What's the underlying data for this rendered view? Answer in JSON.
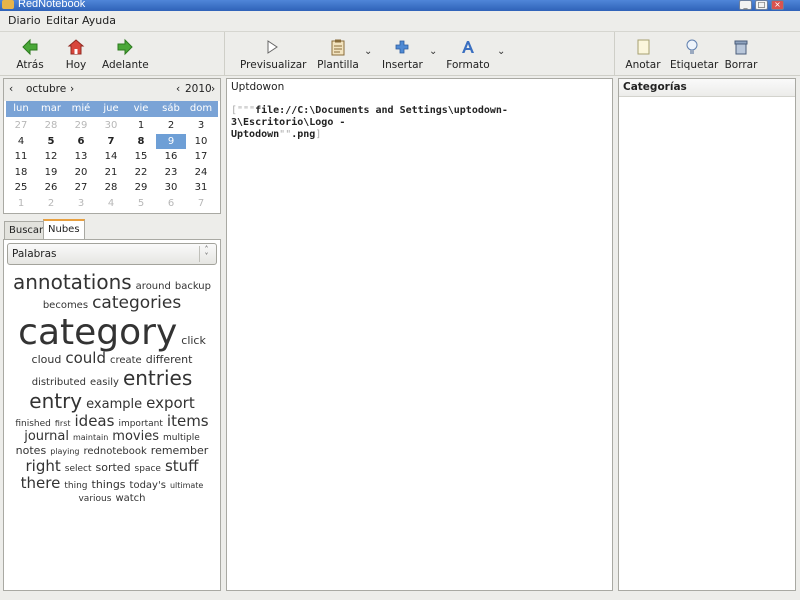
{
  "window": {
    "title": "RedNotebook"
  },
  "menu": [
    "Diario",
    "Editar",
    "Ayuda"
  ],
  "toolbar": {
    "nav": [
      {
        "label": "Atrás",
        "icon": "arrow-left-icon",
        "color": "#3f9a2c"
      },
      {
        "label": "Hoy",
        "icon": "home-icon",
        "color": "#c6332c"
      },
      {
        "label": "Adelante",
        "icon": "arrow-right-icon",
        "color": "#3f9a2c"
      }
    ],
    "edit": [
      {
        "label": "Previsualizar",
        "icon": "play-icon"
      },
      {
        "label": "Plantilla",
        "icon": "clipboard-icon"
      },
      {
        "label": "Insertar",
        "icon": "plus-icon",
        "color": "#3474c2"
      },
      {
        "label": "Formato",
        "icon": "format-text-icon",
        "color": "#3474c2"
      }
    ],
    "right": [
      {
        "label": "Anotar",
        "icon": "note-icon"
      },
      {
        "label": "Etiquetar",
        "icon": "lightbulb-icon"
      },
      {
        "label": "Borrar",
        "icon": "trash-icon"
      }
    ]
  },
  "calendar": {
    "month": "octubre",
    "year": "2010",
    "weekdays": [
      "lun",
      "mar",
      "mié",
      "jue",
      "vie",
      "sáb",
      "dom"
    ],
    "weeks": [
      [
        "27",
        "28",
        "29",
        "30",
        "1",
        "2",
        "3"
      ],
      [
        "4",
        "5",
        "6",
        "7",
        "8",
        "9",
        "10"
      ],
      [
        "11",
        "12",
        "13",
        "14",
        "15",
        "16",
        "17"
      ],
      [
        "18",
        "19",
        "20",
        "21",
        "22",
        "23",
        "24"
      ],
      [
        "25",
        "26",
        "27",
        "28",
        "29",
        "30",
        "31"
      ],
      [
        "1",
        "2",
        "3",
        "4",
        "5",
        "6",
        "7"
      ]
    ],
    "muted": [
      [
        0,
        0
      ],
      [
        0,
        1
      ],
      [
        0,
        2
      ],
      [
        0,
        3
      ],
      [
        5,
        0
      ],
      [
        5,
        1
      ],
      [
        5,
        2
      ],
      [
        5,
        3
      ],
      [
        5,
        4
      ],
      [
        5,
        5
      ],
      [
        5,
        6
      ]
    ],
    "bold": [
      [
        1,
        1
      ],
      [
        1,
        2
      ],
      [
        1,
        3
      ],
      [
        1,
        4
      ]
    ],
    "selected": [
      1,
      5
    ]
  },
  "tabs": {
    "search": "Buscar",
    "clouds": "Nubes"
  },
  "cloud_select": {
    "value": "Palabras"
  },
  "cloud_words": [
    [
      [
        "annotations",
        20
      ],
      [
        "around",
        10
      ],
      [
        "backup",
        10
      ]
    ],
    [
      [
        "becomes",
        10
      ],
      [
        "categories",
        17
      ]
    ],
    [
      [
        "category",
        36
      ],
      [
        "click",
        11
      ]
    ],
    [
      [
        "cloud",
        11
      ],
      [
        "could",
        15
      ],
      [
        "create",
        10
      ],
      [
        "different",
        11
      ]
    ],
    [
      [
        "distributed",
        10
      ],
      [
        "easily",
        10
      ],
      [
        "entries",
        20
      ]
    ],
    [
      [
        "entry",
        20
      ],
      [
        "example",
        13
      ],
      [
        "export",
        15
      ]
    ],
    [
      [
        "finished",
        9
      ],
      [
        "first",
        8
      ],
      [
        "ideas",
        15
      ],
      [
        "important",
        9
      ],
      [
        "items",
        15
      ]
    ],
    [
      [
        "journal",
        13
      ],
      [
        "maintain",
        8
      ],
      [
        "movies",
        13
      ],
      [
        "multiple",
        9
      ]
    ],
    [
      [
        "notes",
        11
      ],
      [
        "playing",
        8
      ],
      [
        "rednotebook",
        10
      ],
      [
        "remember",
        11
      ]
    ],
    [
      [
        "right",
        15
      ],
      [
        "select",
        9
      ],
      [
        "sorted",
        11
      ],
      [
        "space",
        9
      ],
      [
        "stuff",
        15
      ]
    ],
    [
      [
        "there",
        15
      ],
      [
        "thing",
        9
      ],
      [
        "things",
        11
      ],
      [
        "today's",
        10
      ],
      [
        "ultimate",
        8
      ]
    ],
    [
      [
        "various",
        9
      ],
      [
        "watch",
        10
      ]
    ]
  ],
  "editor": {
    "title": "Uptdowon",
    "line1": "file://C:\\Documents and Settings\\uptodown-3\\Escritorio\\Logo -",
    "line2": "Uptodown",
    "line2_tail": ".png"
  },
  "categories": {
    "header": "Categorías"
  }
}
